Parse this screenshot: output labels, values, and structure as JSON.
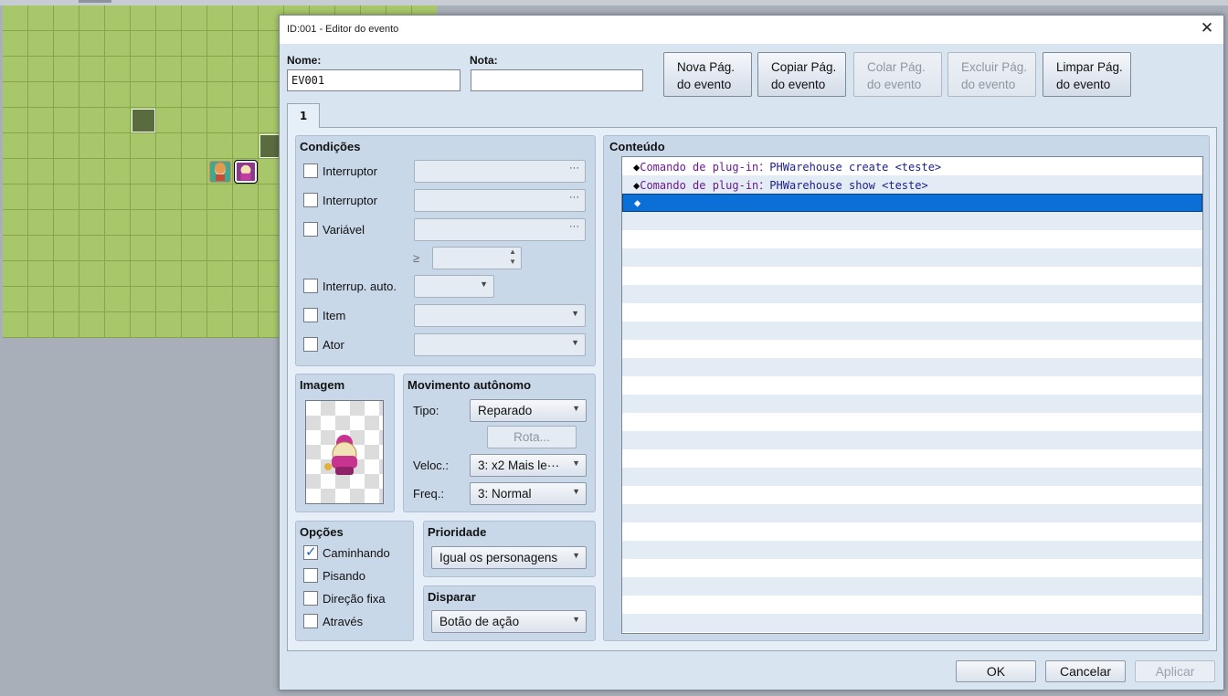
{
  "dialog": {
    "title": "ID:001 - Editor do evento",
    "close_glyph": "✕"
  },
  "header": {
    "name_label": "Nome:",
    "name_value": "EV001",
    "note_label": "Nota:",
    "note_value": ""
  },
  "page_buttons": [
    {
      "line1": "Nova Pág.",
      "line2": "do evento",
      "enabled": true
    },
    {
      "line1": "Copiar Pág.",
      "line2": "do evento",
      "enabled": true
    },
    {
      "line1": "Colar Pág.",
      "line2": "do evento",
      "enabled": false
    },
    {
      "line1": "Excluir Pág.",
      "line2": "do evento",
      "enabled": false
    },
    {
      "line1": "Limpar Pág.",
      "line2": "do evento",
      "enabled": true
    }
  ],
  "tabs": [
    {
      "label": "1"
    }
  ],
  "conditions": {
    "title": "Condições",
    "switch1_label": "Interruptor",
    "switch2_label": "Interruptor",
    "variable_label": "Variável",
    "geq_symbol": "≥",
    "self_switch_label": "Interrup. auto.",
    "item_label": "Item",
    "actor_label": "Ator",
    "dots": "···"
  },
  "image": {
    "title": "Imagem",
    "icon": "character-sprite-icon"
  },
  "movement": {
    "title": "Movimento autônomo",
    "type_label": "Tipo:",
    "type_value": "Reparado",
    "route_label": "Rota...",
    "speed_label": "Veloc.:",
    "speed_value": "3: x2 Mais le···",
    "freq_label": "Freq.:",
    "freq_value": "3: Normal"
  },
  "options": {
    "title": "Opções",
    "walking": {
      "label": "Caminhando",
      "checked": true
    },
    "stepping": {
      "label": "Pisando",
      "checked": false
    },
    "direction_fix": {
      "label": "Direção fixa",
      "checked": false
    },
    "through": {
      "label": "Através",
      "checked": false
    }
  },
  "priority": {
    "title": "Prioridade",
    "value": "Igual os personagens"
  },
  "trigger": {
    "title": "Disparar",
    "value": "Botão de ação"
  },
  "content": {
    "title": "Conteúdo",
    "rows": [
      {
        "marker": "◆",
        "command": "Comando de plug-in",
        "sep": "：",
        "args": "PHWarehouse create <teste>"
      },
      {
        "marker": "◆",
        "command": "Comando de plug-in",
        "sep": "：",
        "args": "PHWarehouse show <teste>"
      },
      {
        "marker": "◆",
        "command": "",
        "sep": "",
        "args": ""
      }
    ]
  },
  "footer": {
    "ok_label": "OK",
    "cancel_label": "Cancelar",
    "apply_label": "Aplicar"
  },
  "colors": {
    "selection": "#0a70d8",
    "panel": "#c9d8e9",
    "grass": "#a7c76a"
  }
}
